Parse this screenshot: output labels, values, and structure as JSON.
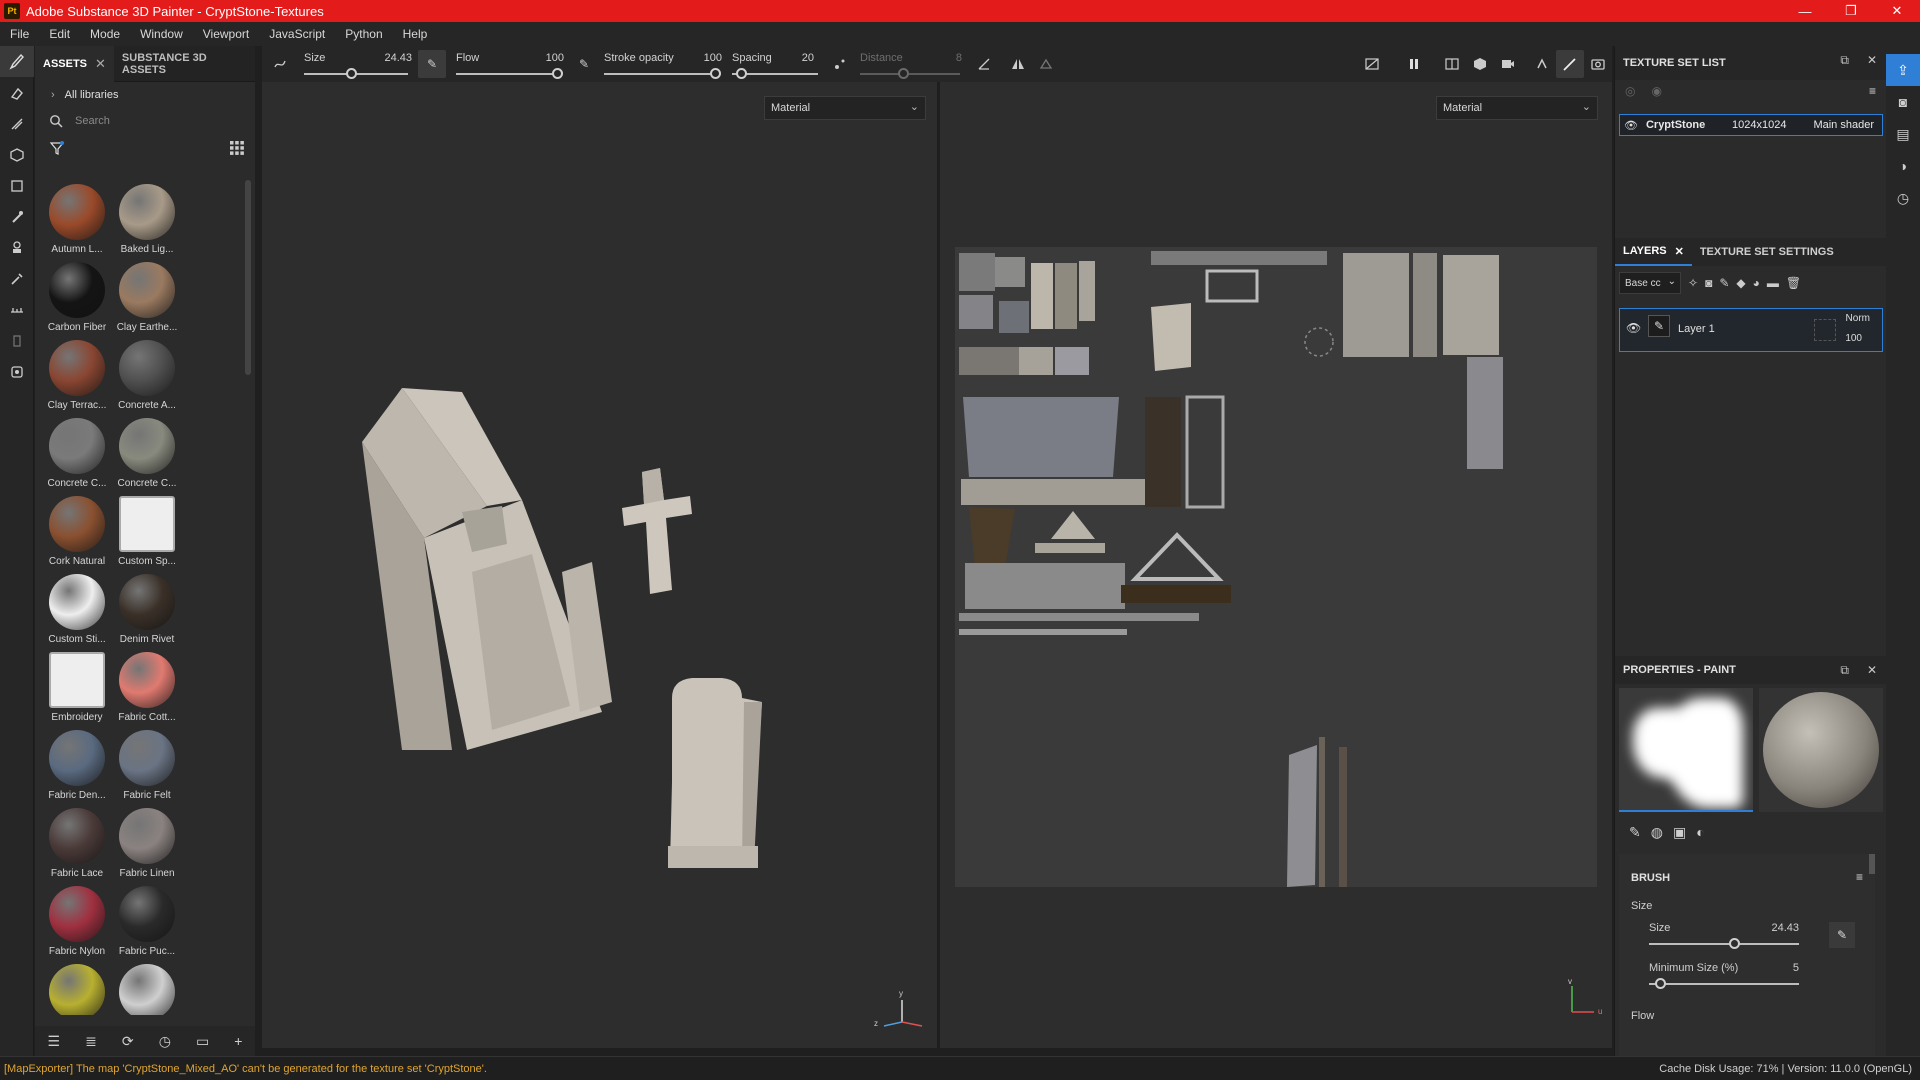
{
  "window": {
    "app_icon": "Pt",
    "title": "Adobe Substance 3D Painter - CryptStone-Textures",
    "controls": [
      "—",
      "❐",
      "✕"
    ]
  },
  "menu": [
    "File",
    "Edit",
    "Mode",
    "Window",
    "Viewport",
    "JavaScript",
    "Python",
    "Help"
  ],
  "assets_panel": {
    "tabs": [
      {
        "label": "ASSETS",
        "active": true
      },
      {
        "label": "SUBSTANCE 3D ASSETS",
        "active": false
      }
    ],
    "libraries_label": "All libraries",
    "search_placeholder": "Search",
    "items": [
      {
        "label": "Autumn L...",
        "color": "#9a4a2a"
      },
      {
        "label": "Baked Lig...",
        "color": "#a89a88"
      },
      {
        "label": "Carbon Fiber",
        "color": "#141414"
      },
      {
        "label": "Clay Earthe...",
        "color": "#9a7a60"
      },
      {
        "label": "Clay Terrac...",
        "color": "#8a4632"
      },
      {
        "label": "Concrete A...",
        "color": "#505050"
      },
      {
        "label": "Concrete C...",
        "color": "#7a7a7a"
      },
      {
        "label": "Concrete C...",
        "color": "#888a7e"
      },
      {
        "label": "Cork Natural",
        "color": "#8a5030"
      },
      {
        "label": "Custom Sp...",
        "color": "#eeeeee"
      },
      {
        "label": "Custom Sti...",
        "color": "#eeeeee"
      },
      {
        "label": "Denim Rivet",
        "color": "#3a3028"
      },
      {
        "label": "Embroidery",
        "color": "#eeeeee"
      },
      {
        "label": "Fabric Cott...",
        "color": "#e07a70"
      },
      {
        "label": "Fabric Den...",
        "color": "#5a6a80"
      },
      {
        "label": "Fabric Felt",
        "color": "#6a7484"
      },
      {
        "label": "Fabric Lace",
        "color": "#4a3a38"
      },
      {
        "label": "Fabric Linen",
        "color": "#8a8280"
      },
      {
        "label": "Fabric Nylon",
        "color": "#a03040"
      },
      {
        "label": "Fabric Puc...",
        "color": "#2a2a2a"
      },
      {
        "label": "",
        "color": "#b8b030"
      },
      {
        "label": "",
        "color": "#cfcfcf"
      }
    ]
  },
  "tool_options": {
    "size": {
      "label": "Size",
      "value": "24.43"
    },
    "flow": {
      "label": "Flow",
      "value": "100"
    },
    "stroke_opacity": {
      "label": "Stroke opacity",
      "value": "100"
    },
    "spacing": {
      "label": "Spacing",
      "value": "20"
    },
    "distance": {
      "label": "Distance",
      "value": "8"
    }
  },
  "viewport": {
    "left_material": "Material",
    "right_material": "Material"
  },
  "texture_set_list": {
    "title": "TEXTURE SET LIST",
    "set_name": "CryptStone",
    "resolution": "1024x1024",
    "shader": "Main shader"
  },
  "layers": {
    "tabs": [
      "LAYERS",
      "TEXTURE SET SETTINGS"
    ],
    "channel": "Base cc",
    "layer_name": "Layer 1",
    "blend": "Norm",
    "opacity": "100"
  },
  "properties": {
    "title": "PROPERTIES - PAINT",
    "section": "BRUSH",
    "group_size": "Size",
    "size_label": "Size",
    "size_value": "24.43",
    "min_size_label": "Minimum Size (%)",
    "min_size_value": "5",
    "flow_group": "Flow"
  },
  "status": {
    "message": "[MapExporter] The map 'CryptStone_Mixed_AO' can't be generated for the texture set 'CryptStone'.",
    "right": "Cache Disk Usage:   71% | Version: 11.0.0 (OpenGL)"
  },
  "colors": {
    "title_bar": "#e31b1b",
    "accent": "#2f7fd6",
    "warning": "#e0a530"
  }
}
